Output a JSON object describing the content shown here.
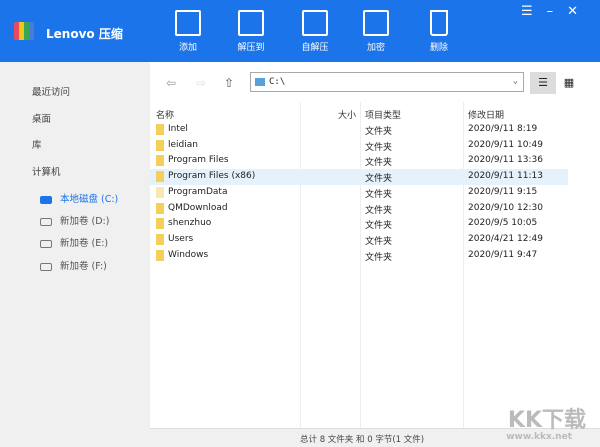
{
  "app": {
    "title": "Lenovo 压缩"
  },
  "toolbar": [
    {
      "label": "添加",
      "icon": "add-archive-icon"
    },
    {
      "label": "解压到",
      "icon": "extract-to-icon"
    },
    {
      "label": "自解压",
      "icon": "self-extract-icon"
    },
    {
      "label": "加密",
      "icon": "encrypt-icon"
    },
    {
      "label": "删除",
      "icon": "trash-icon"
    }
  ],
  "window": {
    "menu": "☰",
    "minimize": "–",
    "close": "✕"
  },
  "sidebar": {
    "items": [
      "最近访问",
      "桌面",
      "库",
      "计算机"
    ],
    "drives": [
      "本地磁盘 (C:)",
      "新加卷 (D:)",
      "新加卷 (E:)",
      "新加卷 (F:)"
    ]
  },
  "nav": {
    "back": "⇦",
    "forward": "⇨",
    "up": "⇧",
    "path": "C:\\",
    "dropdown": "⌄",
    "list_view": "☰",
    "grid_view": "▦"
  },
  "columns": {
    "name": "名称",
    "size": "大小",
    "type": "项目类型",
    "date": "修改日期"
  },
  "files": [
    {
      "name": "Intel",
      "type": "文件夹",
      "date": "2020/9/11 8:19"
    },
    {
      "name": "leidian",
      "type": "文件夹",
      "date": "2020/9/11 10:49"
    },
    {
      "name": "Program Files",
      "type": "文件夹",
      "date": "2020/9/11 13:36"
    },
    {
      "name": "Program Files (x86)",
      "type": "文件夹",
      "date": "2020/9/11 11:13"
    },
    {
      "name": "ProgramData",
      "type": "文件夹",
      "date": "2020/9/11 9:15"
    },
    {
      "name": "QMDownload",
      "type": "文件夹",
      "date": "2020/9/10 12:30"
    },
    {
      "name": "shenzhuo",
      "type": "文件夹",
      "date": "2020/9/5 10:05"
    },
    {
      "name": "Users",
      "type": "文件夹",
      "date": "2020/4/21 12:49"
    },
    {
      "name": "Windows",
      "type": "文件夹",
      "date": "2020/9/11 9:47"
    }
  ],
  "status": "总计 8 文件夹 和 0 字节(1 文件)",
  "watermark": {
    "logo": "KK下载",
    "url": "www.kkx.net"
  },
  "colors": {
    "brand": "#1c74ea",
    "sidebar": "#f0f0f0",
    "selected_row": "#e5f1fb",
    "folder": "#f4cf5c"
  }
}
